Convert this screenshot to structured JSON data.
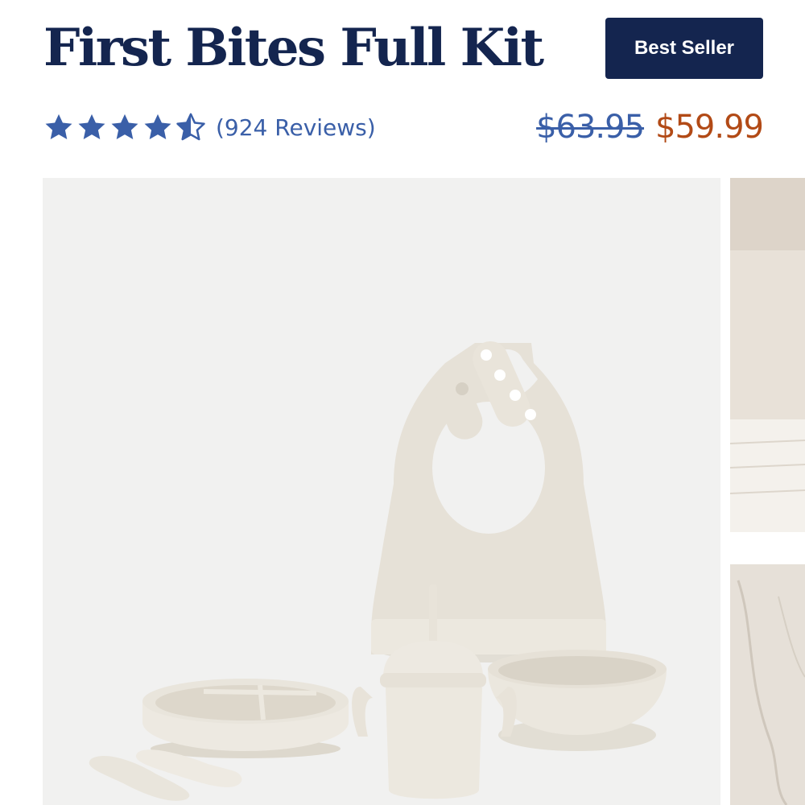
{
  "product": {
    "title": "First Bites Full Kit",
    "badge": "Best Seller",
    "rating": {
      "value": 4.5,
      "max": 5,
      "reviews_label": "(924 Reviews)"
    },
    "price": {
      "original": "$63.95",
      "sale": "$59.99"
    }
  },
  "gallery": {
    "main_image": {
      "items": [
        "bib-icon",
        "suction-plate-icon",
        "sippy-cup-icon",
        "suction-bowl-icon",
        "spoon-icon",
        "fork-icon"
      ]
    },
    "next_image": {
      "items": [
        "stacked-bowls-icon",
        "marble-counter-icon"
      ]
    }
  },
  "colors": {
    "navy": "#14254f",
    "star_blue": "#3a5fa8",
    "sale_orange": "#b24a16",
    "product_cream": "#ece7dd",
    "gallery_bg": "#f1f1f0"
  }
}
